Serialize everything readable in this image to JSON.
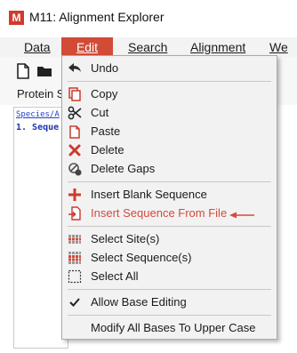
{
  "window": {
    "title": "M11: Alignment Explorer",
    "app_icon": "M"
  },
  "menubar": {
    "data": "Data",
    "edit": "Edit",
    "search": "Search",
    "alignment": "Alignment",
    "we": "We"
  },
  "panel": {
    "label": "Protein S"
  },
  "grid": {
    "header": "Species/A",
    "row1": "1. Seque"
  },
  "edit_menu": {
    "undo": "Undo",
    "copy": "Copy",
    "cut": "Cut",
    "paste": "Paste",
    "delete": "Delete",
    "delete_gaps": "Delete Gaps",
    "insert_blank": "Insert Blank Sequence",
    "insert_from_file": "Insert Sequence From File",
    "select_sites": "Select Site(s)",
    "select_sequences": "Select Sequence(s)",
    "select_all": "Select All",
    "allow_base_editing": "Allow Base Editing",
    "allow_base_editing_checked": true,
    "modify_upper": "Modify All Bases To Upper Case"
  },
  "colors": {
    "accent": "#d14b37",
    "highlight_text": "#d34b3e"
  },
  "icons": [
    "undo-icon",
    "copy-icon",
    "cut-icon",
    "paste-icon",
    "delete-icon",
    "delete-gaps-icon",
    "insert-blank-icon",
    "insert-file-icon",
    "select-sites-icon",
    "select-sequences-icon",
    "select-all-icon",
    "checkmark-icon"
  ]
}
